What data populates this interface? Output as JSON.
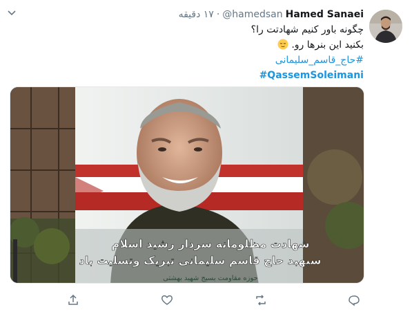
{
  "tweet": {
    "author_name": "Hamed Sanaei",
    "handle": "@hamedsan",
    "separator": "·",
    "time": "۱۷ دقیقه",
    "lines": [
      "چگونه باور کنیم شهادتت را؟",
      "بکنید این بنرها رو."
    ],
    "hashtag_fa": "#حاج_قاسم_سلیمانی",
    "hashtag_en": "#QassemSoleimani"
  },
  "banner": {
    "text_line1": "شهادت مظلومانه سردار رشید اسلام",
    "text_line2": "سپهبد حاج قاسم سلیمانی تبریک وتسلیت باد",
    "text_line3": "حوزه مقاومت بسیج شهید بهشتی"
  },
  "actions": {
    "reply": "reply-icon",
    "retweet": "retweet-icon",
    "like": "heart-icon",
    "share": "share-icon"
  },
  "colors": {
    "link": "#1b95e0",
    "muted": "#657786",
    "text": "#14171a"
  }
}
